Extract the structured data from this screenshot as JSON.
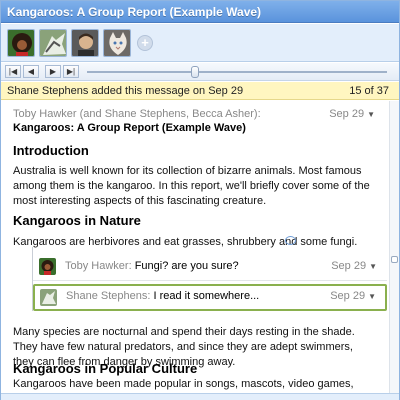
{
  "window": {
    "title": "Kangaroos: A Group Report (Example Wave)"
  },
  "participants": {
    "avatars": [
      "avatar-1",
      "avatar-2",
      "avatar-3",
      "avatar-4"
    ],
    "add_label": "+"
  },
  "playback": {
    "buttons": [
      "|◀",
      "◀",
      "▶",
      "▶|"
    ],
    "position": 0.36
  },
  "infobar": {
    "message": "Shane Stephens added this message on Sep 29",
    "count": "15 of 37"
  },
  "blip": {
    "authors": "Toby Hawker (and Shane Stephens, Becca Asher):",
    "date": "Sep 29",
    "wave_title": "Kangaroos: A Group Report (Example Wave)",
    "sections": {
      "intro_heading": "Introduction",
      "intro_text": "Australia is well known for its collection of bizarre animals. Most famous among them is the kangaroo. In this report, we'll briefly cover some of the most interesting aspects of this fascinating creature.",
      "nature_heading": "Kangaroos in Nature",
      "nature_text": "Kangaroos are herbivores and eat grasses, shrubbery and some fungi.",
      "nocturnal_text": "Many species are nocturnal and spend their days resting in the shade. They have few natural predators, and since they are adept swimmers, they can flee from danger by swimming away.",
      "culture_heading": "Kangaroos in Popular Culture",
      "culture_text": "Kangaroos have been made popular in songs, mascots, video games, cartoon, sculpture, coins and more!"
    }
  },
  "replies": [
    {
      "author": "Toby Hawker:",
      "text": "Fungi? are you sure?",
      "date": "Sep 29"
    },
    {
      "author": "Shane Stephens:",
      "text": "I read it somewhere...",
      "date": "Sep 29"
    }
  ],
  "colors": {
    "titlebar": "#5a93dc",
    "infobar": "#fff6c0",
    "selected_reply_border": "#8ab04e"
  }
}
